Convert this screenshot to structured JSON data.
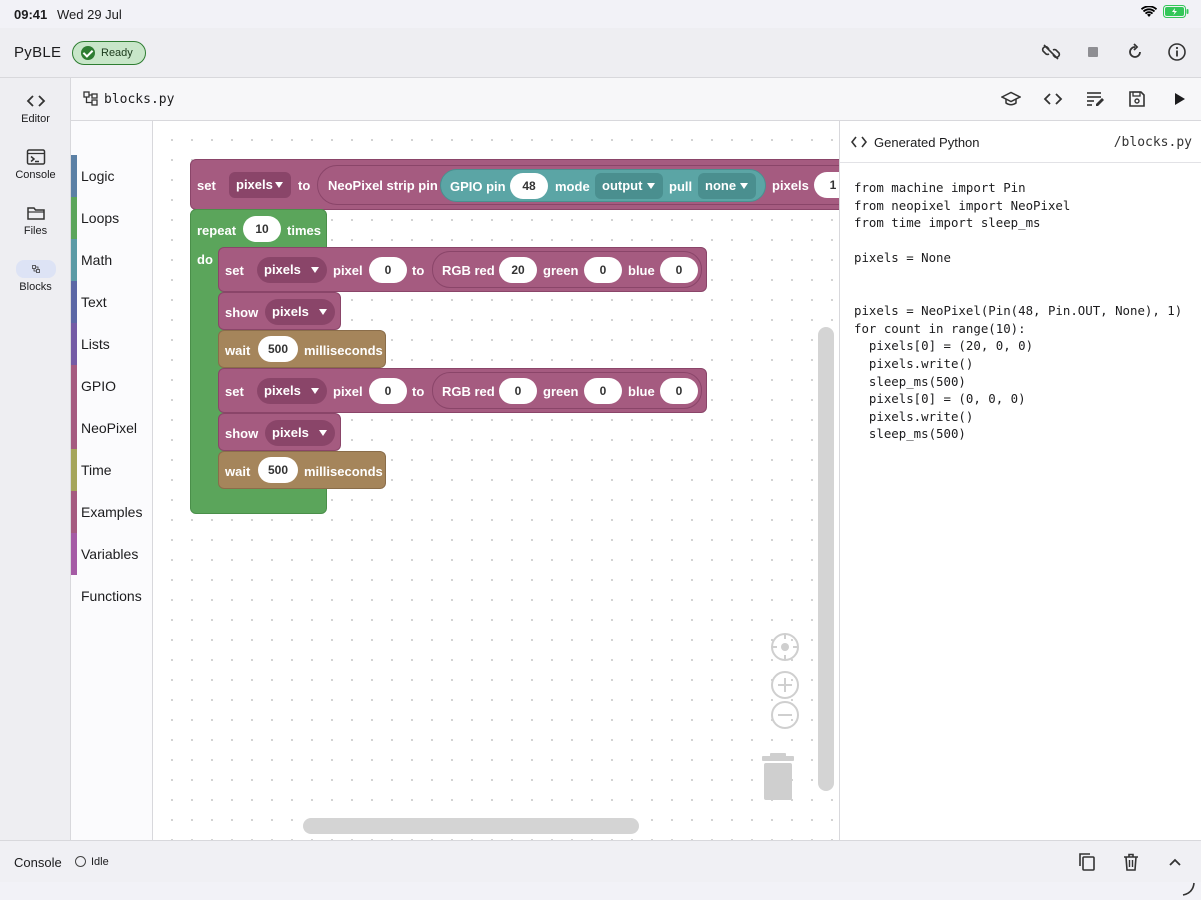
{
  "status_bar": {
    "time": "09:41",
    "date": "Wed 29 Jul"
  },
  "app": {
    "title": "PyBLE",
    "status_badge": "Ready"
  },
  "header_actions": [
    "disconnect-icon",
    "stop-icon",
    "restart-icon",
    "info-icon"
  ],
  "rail": [
    {
      "label": "Editor",
      "icon": "code-icon"
    },
    {
      "label": "Console",
      "icon": "terminal-icon"
    },
    {
      "label": "Files",
      "icon": "folder-icon"
    },
    {
      "label": "Blocks",
      "icon": "blocks-icon",
      "active": true
    }
  ],
  "file": {
    "name": "blocks.py"
  },
  "file_actions": [
    "learn-icon",
    "code-icon",
    "format-icon",
    "save-icon",
    "run-icon"
  ],
  "toolbox": [
    {
      "label": "Logic",
      "color": "#5b80a5"
    },
    {
      "label": "Loops",
      "color": "#5ba55b"
    },
    {
      "label": "Math",
      "color": "#5b67a5"
    },
    {
      "label": "Text",
      "color": "#745ba5"
    },
    {
      "label": "Lists",
      "color": "#745ba5"
    },
    {
      "label": "GPIO",
      "color": "#a55b80"
    },
    {
      "label": "NeoPixel",
      "color": "#a55b80"
    },
    {
      "label": "Time",
      "color": "#a5a55b"
    },
    {
      "label": "Examples",
      "color": "#a55b80"
    },
    {
      "label": "Variables",
      "color": "#a55ba5"
    },
    {
      "label": "Functions",
      "color": "#9a5ca6"
    }
  ],
  "blocks": {
    "set_top": {
      "set": "set",
      "var": "pixels",
      "to": "to",
      "strip": "NeoPixel strip pin",
      "gpio": "GPIO pin",
      "pin": "48",
      "mode": "mode",
      "mode_val": "output",
      "pull": "pull",
      "pull_val": "none",
      "pixels": "pixels",
      "count": "1"
    },
    "repeat": {
      "label": "repeat",
      "times_val": "10",
      "times": "times",
      "do": "do"
    },
    "set1": {
      "set": "set",
      "var": "pixels",
      "pixel": "pixel",
      "index": "0",
      "to": "to",
      "rgb": "RGB red",
      "red": "20",
      "green": "green",
      "green_val": "0",
      "blue": "blue",
      "blue_val": "0"
    },
    "show1": {
      "show": "show",
      "var": "pixels"
    },
    "wait1": {
      "wait": "wait",
      "ms": "500",
      "unit": "milliseconds"
    },
    "set2": {
      "set": "set",
      "var": "pixels",
      "pixel": "pixel",
      "index": "0",
      "to": "to",
      "rgb": "RGB red",
      "red": "0",
      "green": "green",
      "green_val": "0",
      "blue": "blue",
      "blue_val": "0"
    },
    "show2": {
      "show": "show",
      "var": "pixels"
    },
    "wait2": {
      "wait": "wait",
      "ms": "500",
      "unit": "milliseconds"
    }
  },
  "code_panel": {
    "title": "Generated Python",
    "path": "/blocks.py",
    "code": "from machine import Pin\nfrom neopixel import NeoPixel\nfrom time import sleep_ms\n\npixels = None\n\n\npixels = NeoPixel(Pin(48, Pin.OUT, None), 1)\nfor count in range(10):\n  pixels[0] = (20, 0, 0)\n  pixels.write()\n  sleep_ms(500)\n  pixels[0] = (0, 0, 0)\n  pixels.write()\n  sleep_ms(500)"
  },
  "console": {
    "label": "Console",
    "status": "Idle"
  },
  "colors": {
    "neopixel": "#a55b80",
    "gpio": "#5ba5a5",
    "loops": "#5ba55b",
    "time": "#a5855b",
    "dropdown_dark": "#8a4569"
  }
}
